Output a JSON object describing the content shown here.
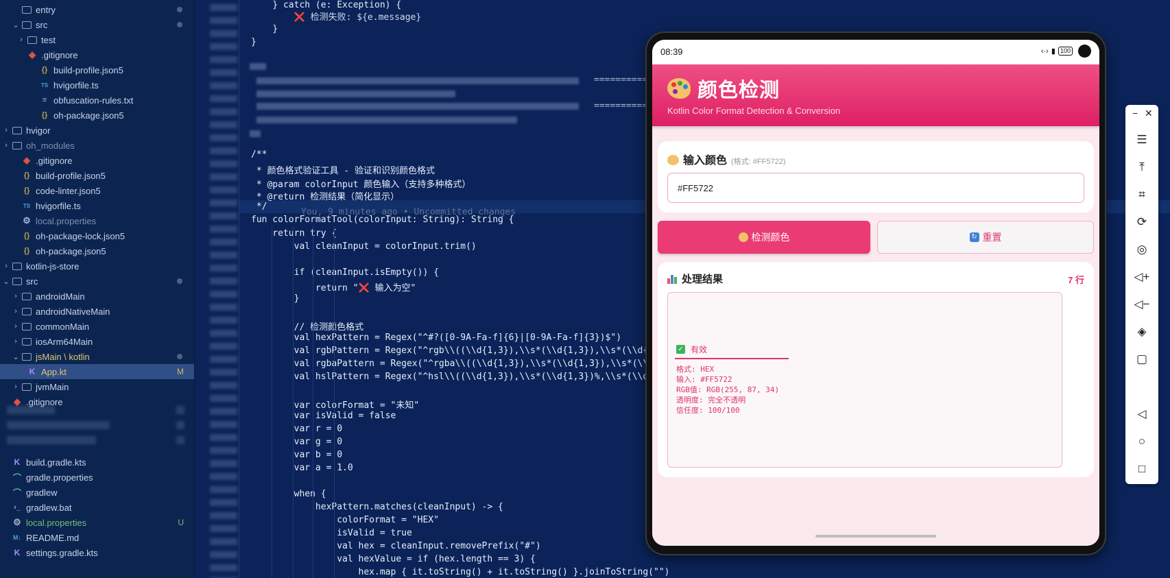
{
  "explorer": {
    "items": [
      {
        "label": "entry",
        "icon": "folder",
        "chev": "",
        "dot": true
      },
      {
        "label": "src",
        "icon": "folder",
        "chev": "⌄",
        "dot": true
      },
      {
        "label": "test",
        "icon": "folder",
        "chev": "›"
      },
      {
        "label": ".gitignore",
        "icon": "git"
      },
      {
        "label": "build-profile.json5",
        "icon": "json"
      },
      {
        "label": "hvigorfile.ts",
        "icon": "ts"
      },
      {
        "label": "obfuscation-rules.txt",
        "icon": "txt"
      },
      {
        "label": "oh-package.json5",
        "icon": "json"
      },
      {
        "label": "hvigor",
        "icon": "folder",
        "chev": "›"
      },
      {
        "label": "oh_modules",
        "icon": "folder",
        "chev": "›"
      },
      {
        "label": ".gitignore",
        "icon": "git"
      },
      {
        "label": "build-profile.json5",
        "icon": "json"
      },
      {
        "label": "code-linter.json5",
        "icon": "json"
      },
      {
        "label": "hvigorfile.ts",
        "icon": "ts"
      },
      {
        "label": "local.properties",
        "icon": "gear"
      },
      {
        "label": "oh-package-lock.json5",
        "icon": "json"
      },
      {
        "label": "oh-package.json5",
        "icon": "json"
      },
      {
        "label": "kotlin-js-store",
        "icon": "folder",
        "chev": "›"
      },
      {
        "label": "src",
        "icon": "folder",
        "chev": "⌄",
        "dot": true
      },
      {
        "label": "androidMain",
        "icon": "folder",
        "chev": "›"
      },
      {
        "label": "androidNativeMain",
        "icon": "folder",
        "chev": "›"
      },
      {
        "label": "commonMain",
        "icon": "folder",
        "chev": "›"
      },
      {
        "label": "iosArm64Main",
        "icon": "folder",
        "chev": "›"
      },
      {
        "label": "jsMain \\ kotlin",
        "icon": "folder",
        "chev": "⌄",
        "dot": true
      },
      {
        "label": "App.kt",
        "icon": "kt",
        "badge": "M"
      },
      {
        "label": "jvmMain",
        "icon": "folder",
        "chev": "›"
      },
      {
        "label": ".gitignore",
        "icon": "git"
      },
      {
        "label": "build.gradle.kts",
        "icon": "kt"
      },
      {
        "label": "gradle.properties",
        "icon": "grad"
      },
      {
        "label": "gradlew",
        "icon": "grad"
      },
      {
        "label": "gradlew.bat",
        "icon": "term"
      },
      {
        "label": "local.properties",
        "icon": "gear",
        "badge": "U"
      },
      {
        "label": "README.md",
        "icon": "md"
      },
      {
        "label": "settings.gradle.kts",
        "icon": "kt"
      }
    ]
  },
  "editor": {
    "blame": "You, 9 minutes ago • Uncommitted changes",
    "lines": [
      "    } catch (e: Exception) {",
      "        ❌ 检测失败: ${e.message}",
      "    }",
      "}",
      "/**",
      " * 颜色格式验证工具 - 验证和识别颜色格式",
      " * @param colorInput 颜色输入（支持多种格式）",
      " * @return 检测结果（简化显示）",
      " */",
      "fun colorFormatTool(colorInput: String): String {",
      "    return try {",
      "        val cleanInput = colorInput.trim()",
      "",
      "        if (cleanInput.isEmpty()) {",
      "            return \"❌ 输入为空\"",
      "        }",
      "",
      "        // 检测颜色格式",
      "        val hexPattern = Regex(\"^#?([0-9A-Fa-f]{6}|[0-9A-Fa-f]{3})$\")",
      "        val rgbPattern = Regex(\"^rgb\\\\((\\\\d{1,3}),\\\\s*(\\\\d{1,3}),\\\\s*(\\\\d{1",
      "        val rgbaPattern = Regex(\"^rgba\\\\((\\\\d{1,3}),\\\\s*(\\\\d{1,3}),\\\\s*(\\\\d",
      "        val hslPattern = Regex(\"^hsl\\\\((\\\\d{1,3}),\\\\s*(\\\\d{1,3})%,\\\\s*(\\\\d{",
      "",
      "        var colorFormat = \"未知\"",
      "        var isValid = false",
      "        var r = 0",
      "        var g = 0",
      "        var b = 0",
      "        var a = 1.0",
      "",
      "        when {",
      "            hexPattern.matches(cleanInput) -> {",
      "                colorFormat = \"HEX\"",
      "                isValid = true",
      "                val hex = cleanInput.removePrefix(\"#\")",
      "                val hexValue = if (hex.length == 3) {",
      "                    hex.map { it.toString() + it.toString() }.joinToString(\"\")"
    ]
  },
  "phone": {
    "status": {
      "time": "08:39",
      "battery": "100"
    },
    "header": {
      "title": "颜色检测",
      "subtitle": "Kotlin Color Format Detection & Conversion"
    },
    "input_card": {
      "title": "输入颜色",
      "hint": "(格式: #FF5722)",
      "value": "#FF5722"
    },
    "buttons": {
      "detect": "检测颜色",
      "reset": "重置"
    },
    "result": {
      "title": "处理结果",
      "count": "7 行",
      "status": "有效",
      "lines": [
        "格式: HEX",
        "输入: #FF5722",
        "RGB值: RGB(255, 87, 34)",
        "透明度: 完全不透明",
        "信任度: 100/100"
      ]
    }
  },
  "toolbar": {
    "minimize": "−",
    "close": "✕",
    "buttons": [
      "menu-icon",
      "pin-top-icon",
      "crop-icon",
      "rotate-icon",
      "location-icon",
      "volume-up-icon",
      "volume-down-icon",
      "fold-icon",
      "square-icon",
      "back-icon",
      "home-icon",
      "recents-icon"
    ]
  },
  "colors": {
    "accent": "#ea3b74",
    "header_start": "#ef4f84",
    "header_end": "#de2063",
    "editor_bg": "#0b2358"
  }
}
